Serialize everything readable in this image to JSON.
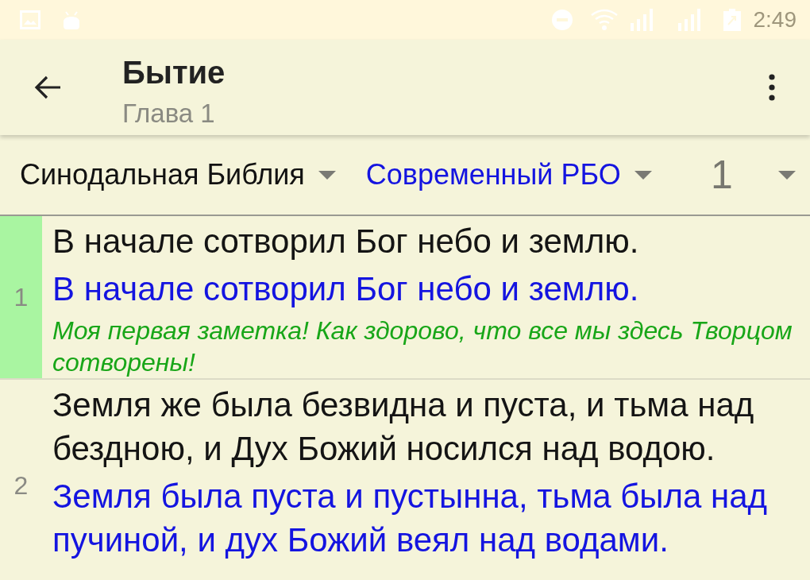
{
  "status_bar": {
    "time": "2:49"
  },
  "app_bar": {
    "title": "Бытие",
    "subtitle": "Глава 1"
  },
  "selectors": [
    {
      "kind": "primary",
      "label": "Синодальная Библия"
    },
    {
      "kind": "secondary",
      "label": "Современный РБО"
    },
    {
      "kind": "chapter",
      "label": "1"
    }
  ],
  "verses": [
    {
      "number": "1",
      "highlighted": true,
      "texts": [
        {
          "kind": "primary",
          "text": "В начале сотворил Бог небо и землю."
        },
        {
          "kind": "secondary",
          "text": "В начале сотворил Бог небо и землю."
        },
        {
          "kind": "note",
          "text": "Моя первая заметка! Как здорово, что все мы здесь Творцом сотворены!"
        }
      ]
    },
    {
      "number": "2",
      "highlighted": false,
      "texts": [
        {
          "kind": "primary",
          "text": "Земля же была безвидна и пуста, и тьма над бездною, и Дух Божий носился над водою."
        },
        {
          "kind": "secondary",
          "text": "Земля была пуста и пустынна, тьма была над пучиной, и дух Божий веял над водами."
        }
      ]
    }
  ]
}
